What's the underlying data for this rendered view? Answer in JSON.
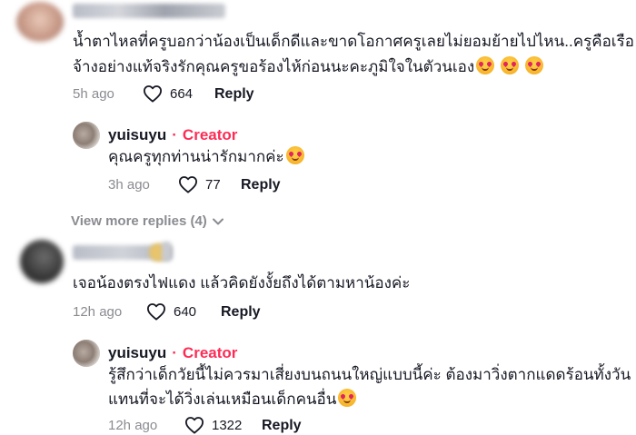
{
  "comments": [
    {
      "text_line1": "น้ำตาไหลที่ครูบอกว่าน้องเป็นเด็กดีและขาดโอกาศครูเลยไม่ยอมย้ายไปไหน..ครูคือเรือ",
      "text_line2": "จ้างอย่างแท้จริงรักคุณครูขอร้องไห้ก่อนนะคะภูมิใจในตัวนเอง",
      "time": "5h ago",
      "likes": "664",
      "reply_label": "Reply",
      "view_more": "View more replies (4)",
      "reply": {
        "username": "yuisuyu",
        "separator": "·",
        "badge": "Creator",
        "text": "คุณครูทุกท่านน่ารักมากค่ะ",
        "time": "3h ago",
        "likes": "77",
        "reply_label": "Reply"
      }
    },
    {
      "text_line1": "เจอน้องตรงไฟแดง แล้วคิดยังงั้ยถึงได้ตามหาน้องค่ะ",
      "time": "12h ago",
      "likes": "640",
      "reply_label": "Reply",
      "reply": {
        "username": "yuisuyu",
        "separator": "·",
        "badge": "Creator",
        "text_line1": "รู้สึกว่าเด็กวัยนี้ไม่ควรมาเสี่ยงบนถนนใหญ่แบบนี้ค่ะ ต้องมาวิ่งตากแดดร้อนทั้งวัน",
        "text_line2": "แทนที่จะได้วิ่งเล่นเหมือนเด็กคนอื่น",
        "time": "12h ago",
        "likes": "1322",
        "reply_label": "Reply"
      }
    }
  ],
  "icons": {
    "heart": "heart-outline-icon",
    "chevron": "chevron-down-icon",
    "emoji": "smiling-face-with-hearts-emoji"
  },
  "colors": {
    "accent": "#fe2c55",
    "text": "#161823",
    "muted": "#8a8b91"
  }
}
